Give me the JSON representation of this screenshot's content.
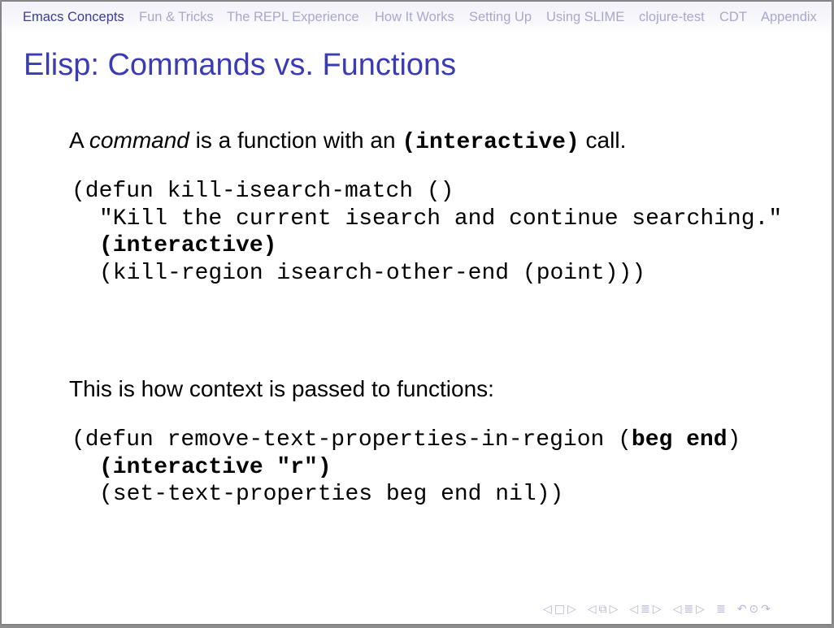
{
  "navbar": {
    "items": [
      {
        "label": "Emacs Concepts",
        "active": true
      },
      {
        "label": "Fun & Tricks",
        "active": false
      },
      {
        "label": "The REPL Experience",
        "active": false
      },
      {
        "label": "How It Works",
        "active": false
      },
      {
        "label": "Setting Up",
        "active": false
      },
      {
        "label": "Using SLIME",
        "active": false
      },
      {
        "label": "clojure-test",
        "active": false
      },
      {
        "label": "CDT",
        "active": false
      },
      {
        "label": "Appendix",
        "active": false
      }
    ]
  },
  "frame": {
    "title": "Elisp: Commands vs. Functions"
  },
  "content": {
    "para1": {
      "prefix": "A ",
      "emphasis": "command",
      "middle": " is a function with an ",
      "code": "(interactive)",
      "suffix": " call."
    },
    "code1": {
      "line1": "(defun kill-isearch-match ()",
      "line2": "\"Kill the current isearch and continue searching.\"",
      "line3": "(interactive)",
      "line4": "(kill-region isearch-other-end (point)))"
    },
    "para2": {
      "text": "This is how context is passed to functions:"
    },
    "code2": {
      "line1_a": "(defun remove-text-properties-in-region (",
      "line1_b": "beg end",
      "line1_c": ")",
      "line2": "(interactive \"r\")",
      "line3": "(set-text-properties beg end nil))"
    }
  },
  "beamer_nav": {
    "prev_frame": "◁",
    "frame_icon": "□",
    "next_frame": "▷",
    "prev_subsection": "◁",
    "subsection_icon": "⧉",
    "next_subsection": "▷",
    "prev_section_left": "◁",
    "section_icon": "≣",
    "next_section_right": "▷",
    "prev_part": "◁",
    "part_icon": "≣",
    "next_part": "▷",
    "document_icon": "≣",
    "back_icon": "↶",
    "search_icon": "⊙",
    "forward_icon": "↷"
  },
  "colors": {
    "nav_active": "#3c3c9b",
    "nav_inactive": "#a8a8ce",
    "title": "#3b3bb6"
  }
}
